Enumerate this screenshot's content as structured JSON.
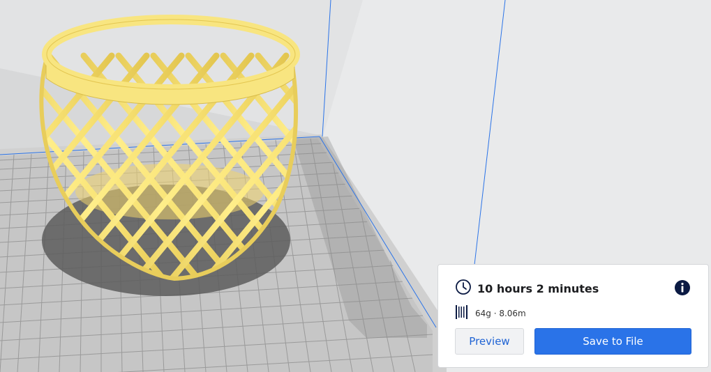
{
  "print_panel": {
    "estimated_time": "10 hours 2 minutes",
    "material_usage": "64g · 8.06m",
    "preview_label": "Preview",
    "save_label": "Save to File"
  },
  "icons": {
    "time": "clock-icon",
    "info": "info-icon",
    "material": "filament-spool-icon"
  },
  "colors": {
    "model_color": "#f8e580",
    "accent_blue": "#2a73e8",
    "build_plate": "#c6c6c6",
    "plate_grid": "#9a9a9a",
    "info_icon": "#0b1a43"
  }
}
